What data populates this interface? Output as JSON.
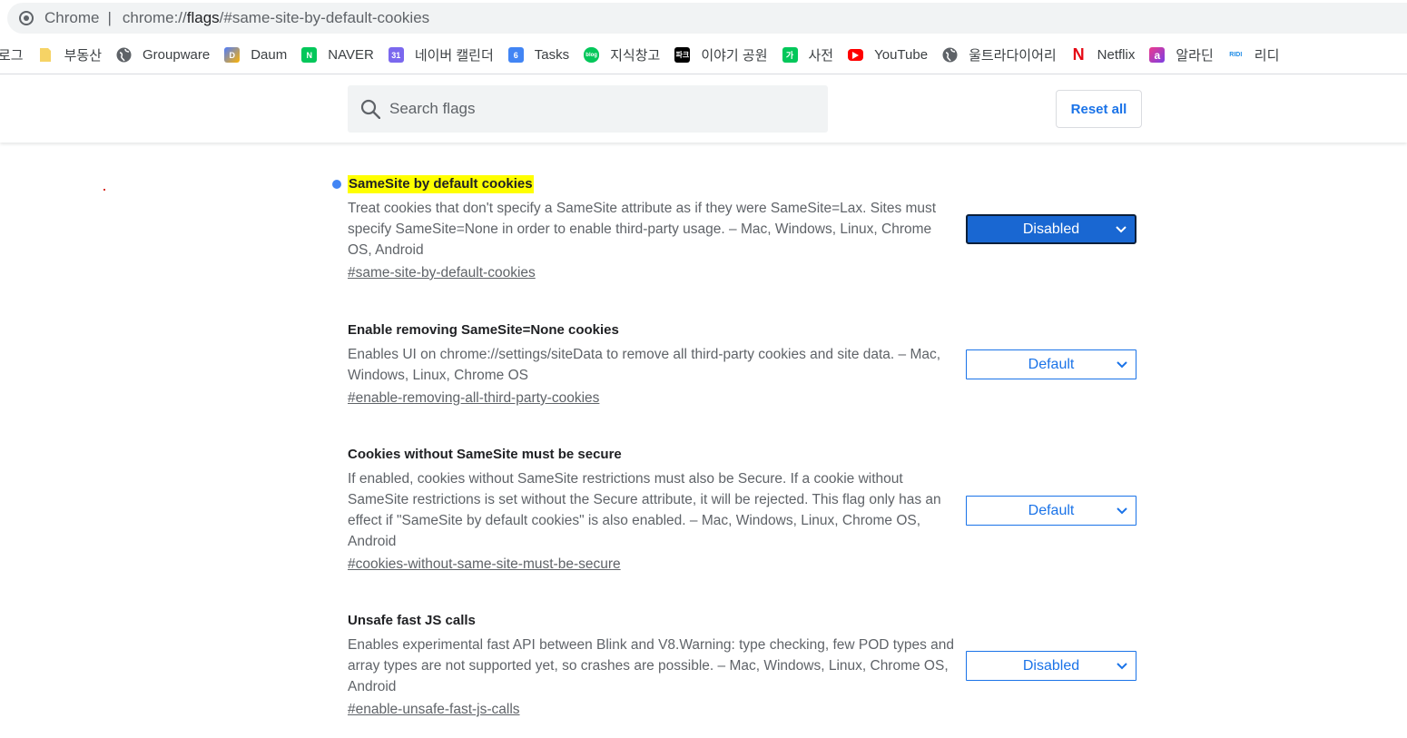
{
  "omnibox": {
    "chip": "Chrome",
    "separator": "|",
    "url_prefix": "chrome://",
    "url_host": "flags",
    "url_rest": "/#same-site-by-default-cookies"
  },
  "bookmarks": [
    {
      "label": "로그",
      "icon": "none"
    },
    {
      "label": "부동산",
      "icon": "folder-icon",
      "color": "#f6d365"
    },
    {
      "label": "Groupware",
      "icon": "globe-icon",
      "color": "#5f6368"
    },
    {
      "label": "Daum",
      "icon": "daum-icon",
      "color": "#4d7cfe"
    },
    {
      "label": "NAVER",
      "icon": "naver-icon",
      "color": "#03c75a"
    },
    {
      "label": "네이버 캘린더",
      "icon": "calendar-icon",
      "color": "#7b68ee"
    },
    {
      "label": "Tasks",
      "icon": "tasks-icon",
      "color": "#4285f4"
    },
    {
      "label": "지식창고",
      "icon": "blog-icon",
      "color": "#03c75a"
    },
    {
      "label": "이야기 공원",
      "icon": "story-icon",
      "color": "#000000"
    },
    {
      "label": "사전",
      "icon": "dictionary-icon",
      "color": "#03c75a"
    },
    {
      "label": "YouTube",
      "icon": "youtube-icon",
      "color": "#ff0000"
    },
    {
      "label": "울트라다이어리",
      "icon": "globe-icon",
      "color": "#5f6368"
    },
    {
      "label": "Netflix",
      "icon": "netflix-icon",
      "color": "#e50914"
    },
    {
      "label": "알라딘",
      "icon": "aladin-icon",
      "color": "#ee3a8c"
    },
    {
      "label": "리디",
      "icon": "ridi-icon",
      "color": "#1f8ce6"
    }
  ],
  "header": {
    "search_placeholder": "Search flags",
    "reset_label": "Reset all"
  },
  "experiments": [
    {
      "title": "SameSite by default cookies",
      "description": "Treat cookies that don't specify a SameSite attribute as if they were SameSite=Lax. Sites must specify SameSite=None in order to enable third-party usage. – Mac, Windows, Linux, Chrome OS, Android",
      "link": "#same-site-by-default-cookies",
      "value": "Disabled",
      "highlighted": true,
      "modified": true
    },
    {
      "title": "Enable removing SameSite=None cookies",
      "description": "Enables UI on chrome://settings/siteData to remove all third-party cookies and site data. – Mac, Windows, Linux, Chrome OS",
      "link": "#enable-removing-all-third-party-cookies",
      "value": "Default"
    },
    {
      "title": "Cookies without SameSite must be secure",
      "description": "If enabled, cookies without SameSite restrictions must also be Secure. If a cookie without SameSite restrictions is set without the Secure attribute, it will be rejected. This flag only has an effect if \"SameSite by default cookies\" is also enabled. – Mac, Windows, Linux, Chrome OS, Android",
      "link": "#cookies-without-same-site-must-be-secure",
      "value": "Default"
    },
    {
      "title": "Unsafe fast JS calls",
      "description": "Enables experimental fast API between Blink and V8.Warning: type checking, few POD types and array types are not supported yet, so crashes are possible. – Mac, Windows, Linux, Chrome OS, Android",
      "link": "#enable-unsafe-fast-js-calls",
      "value": "Disabled"
    }
  ],
  "colors": {
    "accent": "#1a73e8",
    "active_select": "#1967d2",
    "highlight": "#ffff00",
    "modified_dot": "#4285f4"
  }
}
